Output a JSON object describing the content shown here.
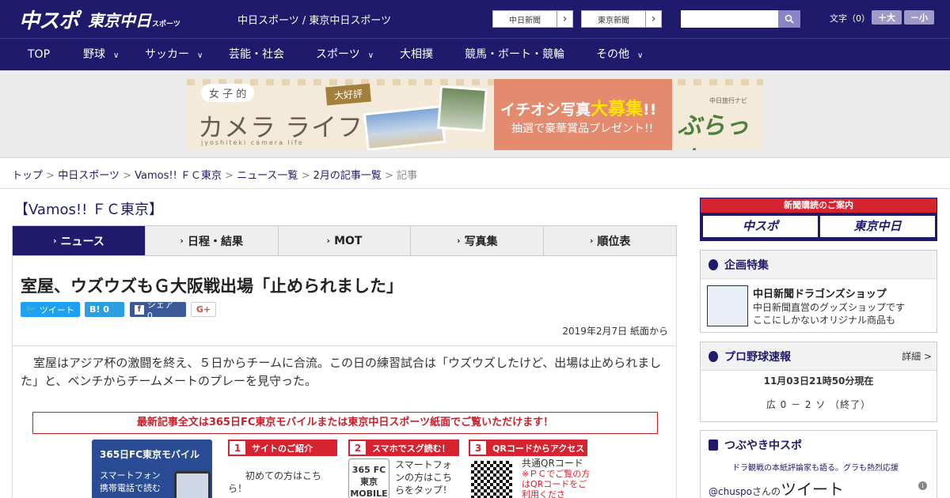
{
  "header": {
    "logo_main": "中スポ",
    "logo_tokyo": "東京中日",
    "logo_sports": "スポーツ",
    "site_name": "中日スポーツ / 東京中日スポーツ",
    "link_chunichi": "中日新聞",
    "link_tokyo": "東京新聞",
    "search_placeholder": "",
    "font_size_label": "文字（0）",
    "font_bigger": "＋大",
    "font_smaller": "－小"
  },
  "nav": {
    "items": [
      "TOP",
      "野球",
      "サッカー",
      "芸能・社会",
      "スポーツ",
      "大相撲",
      "競馬・ボート・競輪",
      "その他"
    ]
  },
  "banner": {
    "girl": "女 子 的",
    "title": "カメラ ライフ",
    "romaji": "jyoshiteki camera life",
    "tag": "大好評",
    "line1": "イチオシ写真",
    "line1_big": "大募集",
    "line1_end": "!!",
    "line2": "抽選で豪華賞品プレゼント!!",
    "navi": "中日旅行ナビ",
    "pla": "ぶらっ人"
  },
  "breadcrumb": {
    "items": [
      "トップ",
      "中日スポーツ",
      "Vamos!! ＦＣ東京",
      "ニュース一覧",
      "2月の記事一覧"
    ],
    "current": "記事"
  },
  "section_title": "【Vamos!! ＦＣ東京】",
  "tabs": [
    "ニュース",
    "日程・結果",
    "MOT",
    "写真集",
    "順位表"
  ],
  "article": {
    "title": "室屋、ウズウズもＧ大阪戦出場「止められました」",
    "tweet": "ツイート",
    "hatena": "B! 0",
    "share": "シェア 0",
    "gplus": "G+",
    "date": "2019年2月7日 紙面から",
    "body": "室屋はアジア杯の激闘を終え、５日からチームに合流。この日の練習試合は「ウズウズしたけど、出場は止められました」と、ベンチからチームメートのプレーを見守った。",
    "promo": "最新記事全文は365日FC東京モバイルまたは東京中日スポーツ紙面でご覧いただけます！",
    "mobile_title": "365日FC東京モバイル",
    "mobile_text1": "スマートフォン",
    "mobile_text2": "携帯電話で読む",
    "step1_num": "1",
    "step1": "サイトのご紹介",
    "step1_text": "初めての方はこちら！",
    "step2_num": "2",
    "step2": "スマホでスグ読む！",
    "step2_img": "365 FC東京 MOBILE",
    "step2_text": "スマートフォンの方はこちらをタップ！",
    "step3_num": "3",
    "step3": "QRコードからアクセス",
    "step3_text": "共通QRコード",
    "step3_red": "※ＰＣでご覧の方はQRコードをご利用くださ"
  },
  "sidebar": {
    "news_header": "新聞購読のご案内",
    "news_btn1": "中スポ",
    "news_btn2": "東京中日",
    "kikaku_title": "企画特集",
    "kikaku_item": "中日新聞ドラゴンズショップ",
    "kikaku_desc1": "中日新聞直営のグッズショップです",
    "kikaku_desc2": "ここにしかないオリジナル商品も",
    "baseball_title": "プロ野球速報",
    "baseball_more": "詳細 >",
    "baseball_time": "11月03日21時50分現在",
    "baseball_score": "広 0 － 2 ソ （終了）",
    "tweet_title": "つぶやき中スポ",
    "tweet_sub": "ドラ観戦の本紙評論家も語る。グラも熱烈応援",
    "tweet_acc": "@chuspo",
    "tweet_san": "さんの",
    "tweet_big": "ツイート"
  },
  "colors": {
    "navy": "#1f1a6b",
    "red": "#d7222f"
  }
}
